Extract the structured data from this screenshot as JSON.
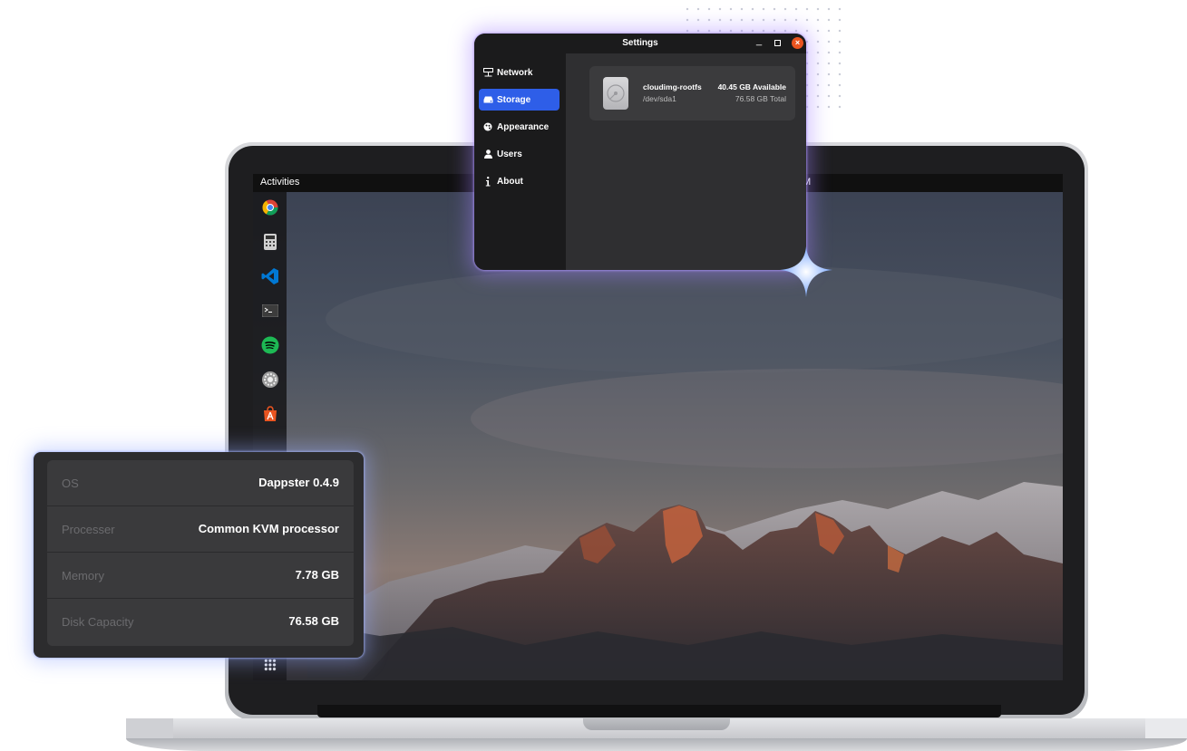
{
  "colors": {
    "accent": "#2e5ee8",
    "close_button": "#e95420",
    "glow": "#a482ff",
    "panel": "#2c2c2e"
  },
  "desktop": {
    "topbar": {
      "activities_label": "Activities",
      "clock_fragment": "M"
    },
    "dock": {
      "apps": [
        {
          "name": "chrome-icon"
        },
        {
          "name": "calculator-icon"
        },
        {
          "name": "vscode-icon"
        },
        {
          "name": "terminal-icon"
        },
        {
          "name": "spotify-icon"
        },
        {
          "name": "settings-gear-icon"
        },
        {
          "name": "app-store-icon"
        }
      ],
      "show_apps_icon": "app-grid-icon"
    }
  },
  "settings_window": {
    "title": "Settings",
    "controls": {
      "minimize": "_",
      "close": "×"
    },
    "sidebar": {
      "items": [
        {
          "label": "Network",
          "icon": "network-icon",
          "active": false
        },
        {
          "label": "Storage",
          "icon": "storage-icon",
          "active": true
        },
        {
          "label": "Appearance",
          "icon": "appearance-icon",
          "active": false
        },
        {
          "label": "Users",
          "icon": "user-icon",
          "active": false
        },
        {
          "label": "About",
          "icon": "info-icon",
          "active": false
        }
      ]
    },
    "storage": {
      "disk_name": "cloudimg-rootfs",
      "device": "/dev/sda1",
      "available": "40.45 GB Available",
      "total": "76.58 GB Total"
    }
  },
  "system_info": {
    "rows": [
      {
        "label": "OS",
        "value": "Dappster 0.4.9"
      },
      {
        "label": "Processer",
        "value": "Common KVM processor"
      },
      {
        "label": "Memory",
        "value": "7.78 GB"
      },
      {
        "label": "Disk Capacity",
        "value": "76.58 GB"
      }
    ]
  }
}
